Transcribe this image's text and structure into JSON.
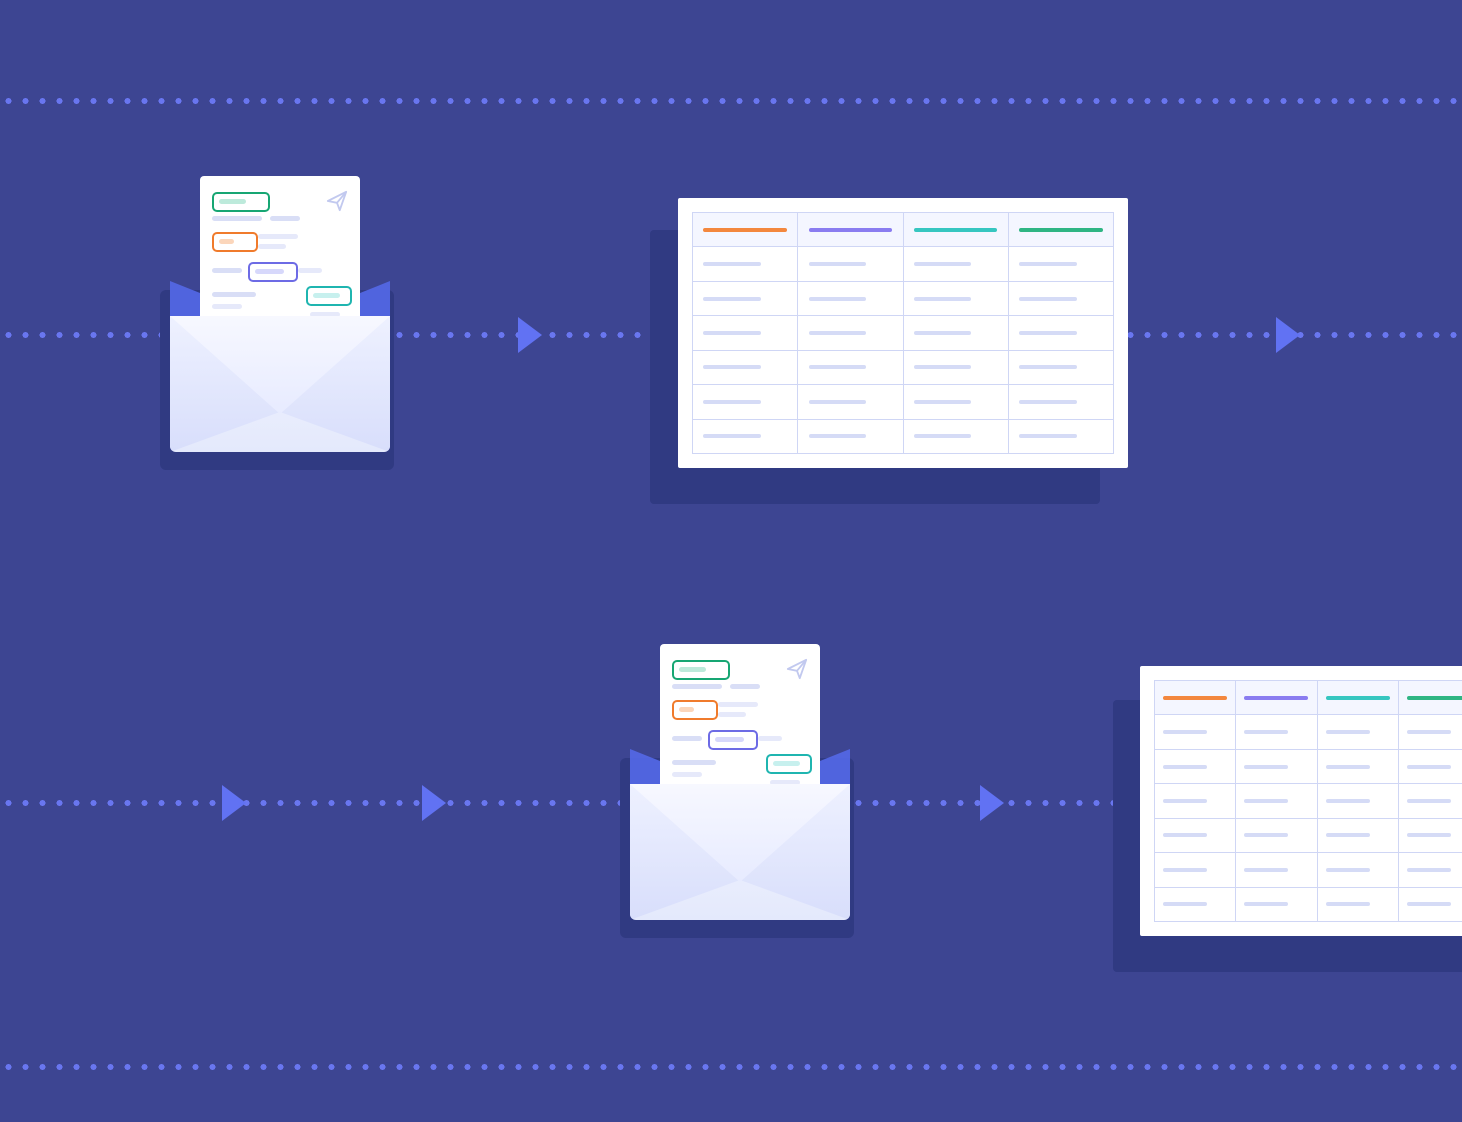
{
  "diagram": {
    "background_color": "#3d4592",
    "dot_color": "#6976f0",
    "arrow_color": "#6172f3",
    "shadow_color": "#303a82"
  },
  "spreadsheet_header_colors": {
    "col1": "orange",
    "col2": "violet",
    "col3": "teal",
    "col4": "green"
  },
  "rows": [
    {
      "elements": [
        {
          "type": "envelope"
        },
        {
          "type": "arrow"
        },
        {
          "type": "spreadsheet",
          "columns": 4,
          "body_rows": 6
        },
        {
          "type": "arrow"
        }
      ]
    },
    {
      "elements": [
        {
          "type": "arrow"
        },
        {
          "type": "arrow"
        },
        {
          "type": "envelope"
        },
        {
          "type": "arrow"
        },
        {
          "type": "spreadsheet",
          "columns": 4,
          "body_rows": 6,
          "clipped_right": true
        }
      ]
    }
  ]
}
